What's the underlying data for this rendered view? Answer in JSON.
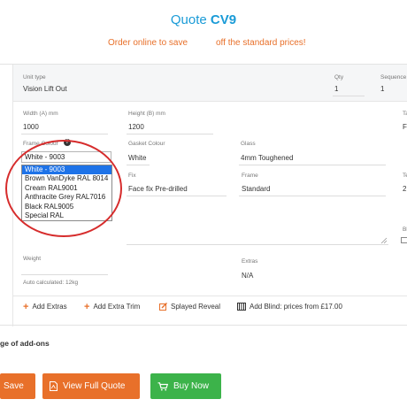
{
  "header": {
    "title_prefix": "Quote ",
    "title_code": "CV9",
    "promo_left": "Order online to save",
    "promo_right": "off the standard prices!"
  },
  "form": {
    "unit_type": {
      "label": "Unit type",
      "value": "Vision Lift Out"
    },
    "qty": {
      "label": "Qty",
      "value": "1"
    },
    "sequence": {
      "label": "Sequence",
      "value": "1"
    },
    "width": {
      "label": "Width (A) mm",
      "value": "1000"
    },
    "height": {
      "label": "Height (B) mm",
      "value": "1200"
    },
    "right_col_top": {
      "label": "Ta",
      "value": "F"
    },
    "frame_colour": {
      "label": "Frame Colour",
      "help": "?",
      "selected": "White - 9003",
      "options": [
        "White - 9003",
        "Brown VanDyke RAL 8014",
        "Cream RAL9001",
        "Anthracite Grey RAL7016",
        "Black RAL9005",
        "Special RAL"
      ]
    },
    "gasket_colour": {
      "label": "Gasket Colour",
      "value": "White"
    },
    "glass": {
      "label": "Glass",
      "value": "4mm Toughened"
    },
    "fix": {
      "label": "Fix",
      "value": "Face fix Pre-drilled"
    },
    "frame": {
      "label": "Frame",
      "value": "Standard"
    },
    "right_col_mid": {
      "label": "Te",
      "value": "2"
    },
    "right_col_bl": {
      "label": "Bl"
    },
    "weight": {
      "label": "Weight",
      "note": "Auto calculated: 12kg"
    },
    "extras": {
      "label": "Extras",
      "value": "N/A"
    }
  },
  "actions": {
    "add_extras": "Add Extras",
    "add_extra_trim": "Add Extra Trim",
    "splayed_reveal": "Splayed Reveal",
    "add_blind": "Add Blind: prices from £17.00"
  },
  "addons_label": "ge of add-ons",
  "buttons": {
    "save": "Save",
    "view_full_quote": "View Full Quote",
    "buy_now": "Buy Now"
  },
  "colors": {
    "accent_blue": "#1a9bd7",
    "orange": "#e8702a",
    "green": "#3cb34a",
    "annotation_red": "#d62c2c"
  }
}
